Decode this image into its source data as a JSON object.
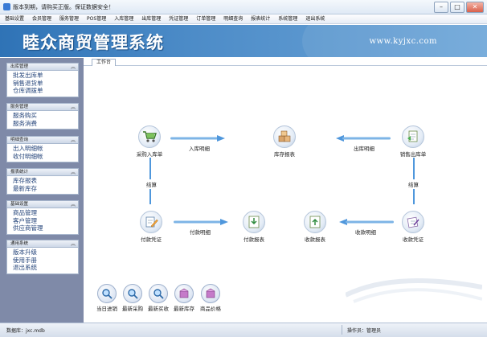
{
  "window": {
    "title": "版本到期，请购买正版。保证数据安全！",
    "controls": [
      "–",
      "□",
      "✕"
    ]
  },
  "menu": [
    "基础设置",
    "会员管理",
    "服务管理",
    "POS管理",
    "入库管理",
    "出库管理",
    "凭证管理",
    "订单管理",
    "明细查询",
    "报表统计",
    "系统管理",
    "退出系统"
  ],
  "banner": {
    "app_name": "睦众商贸管理系统",
    "url": "www.kyjxc.com"
  },
  "sidebar": {
    "groups": [
      {
        "title": "出库管理",
        "items": [
          "批发出库单",
          "销售退货单",
          "仓库调拨单"
        ]
      },
      {
        "title": "服务管理",
        "items": [
          "服务购买",
          "服务消费"
        ]
      },
      {
        "title": "明细查询",
        "items": [
          "出入明细帐",
          "收付明细帐"
        ]
      },
      {
        "title": "报表统计",
        "items": [
          "库存报表",
          "最新库存"
        ]
      },
      {
        "title": "基础设置",
        "items": [
          "商品管理",
          "客户管理",
          "供应商管理"
        ]
      },
      {
        "title": "通用系统",
        "items": [
          "版本升级",
          "使用手册",
          "退出系统"
        ]
      }
    ]
  },
  "tab": {
    "label": "工作台"
  },
  "flow": {
    "nodes": {
      "purchase": "采购入库单",
      "inventory": "库存报表",
      "sales": "销售出库单",
      "payment_voucher": "付款凭证",
      "payment_report": "付款报表",
      "receipt_report": "收款报表",
      "receipt_voucher": "收款凭证"
    },
    "labels": {
      "in_detail": "入库明细",
      "out_detail": "出库明细",
      "settle_left": "结算",
      "settle_right": "结算",
      "pay_detail": "付款明细",
      "receive_detail": "收款明细"
    }
  },
  "quick": [
    "当日进销",
    "最新采购",
    "最新买收",
    "最新库存",
    "商品价格"
  ],
  "status": {
    "database": "数据库：jxc.mdb",
    "operator": "操作员：管理员"
  },
  "colors": {
    "banner": "#3a7fc1",
    "sidebar": "#7f8aa8",
    "arrow": "#4f97dc"
  }
}
